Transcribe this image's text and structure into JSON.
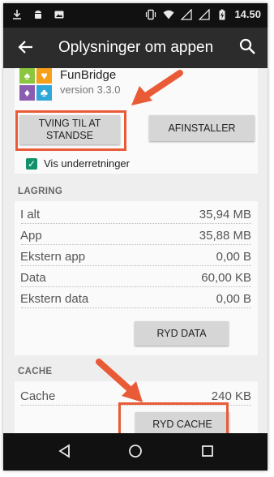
{
  "status_bar": {
    "time": "14.50",
    "left_icons": [
      "download-icon",
      "android-icon",
      "image-icon"
    ],
    "right_icons": [
      "vibrate-icon",
      "wifi-icon",
      "signal-icon",
      "signal-icon",
      "battery-charging-icon"
    ]
  },
  "toolbar": {
    "title": "Oplysninger om appen",
    "back_icon": "arrow-back-icon",
    "search_icon": "search-icon"
  },
  "app": {
    "name": "FunBridge",
    "version": "version 3.3.0",
    "icon": "funbridge-logo"
  },
  "buttons": {
    "force_stop": "TVING TIL AT STANDSE",
    "uninstall": "AFINSTALLER",
    "clear_data": "RYD DATA",
    "clear_cache": "RYD CACHE"
  },
  "notifications": {
    "label": "Vis underretninger",
    "checked": true
  },
  "storage": {
    "header": "LAGRING",
    "rows": [
      {
        "label": "I alt",
        "value": "35,94 MB"
      },
      {
        "label": "App",
        "value": "35,88 MB"
      },
      {
        "label": "Ekstern app",
        "value": "0,00 B"
      },
      {
        "label": "Data",
        "value": "60,00 KB"
      },
      {
        "label": "Ekstern data",
        "value": "0,00 B"
      }
    ]
  },
  "cache": {
    "header": "CACHE",
    "rows": [
      {
        "label": "Cache",
        "value": "240 KB"
      }
    ]
  },
  "annotations": {
    "color": "#e95a37"
  },
  "nav": {
    "back": "nav-back-icon",
    "home": "nav-home-icon",
    "recents": "nav-recents-icon"
  },
  "colors": {
    "toolbar": "#2c2c2c",
    "checkbox": "#14916c",
    "button": "#d6d6d6"
  }
}
